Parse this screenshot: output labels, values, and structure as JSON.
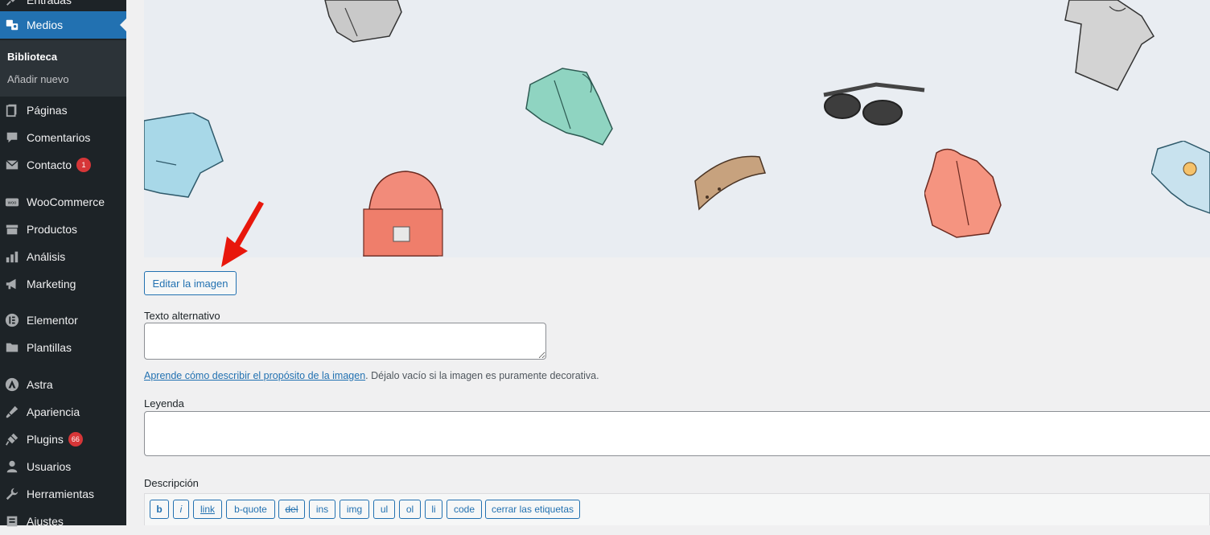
{
  "sidebar": {
    "items": [
      {
        "label": "Entradas",
        "icon": "pin-icon"
      },
      {
        "label": "Medios",
        "icon": "media-icon",
        "active": true
      },
      {
        "label": "Páginas",
        "icon": "pages-icon"
      },
      {
        "label": "Comentarios",
        "icon": "comments-icon"
      },
      {
        "label": "Contacto",
        "icon": "mail-icon",
        "badge": "1"
      },
      {
        "label": "WooCommerce",
        "icon": "woocommerce-icon"
      },
      {
        "label": "Productos",
        "icon": "products-icon"
      },
      {
        "label": "Análisis",
        "icon": "analytics-icon"
      },
      {
        "label": "Marketing",
        "icon": "megaphone-icon"
      },
      {
        "label": "Elementor",
        "icon": "elementor-icon"
      },
      {
        "label": "Plantillas",
        "icon": "folder-icon"
      },
      {
        "label": "Astra",
        "icon": "astra-icon"
      },
      {
        "label": "Apariencia",
        "icon": "brush-icon"
      },
      {
        "label": "Plugins",
        "icon": "plugin-icon",
        "badge": "66"
      },
      {
        "label": "Usuarios",
        "icon": "users-icon"
      },
      {
        "label": "Herramientas",
        "icon": "wrench-icon"
      },
      {
        "label": "Ajustes",
        "icon": "settings-icon"
      }
    ],
    "submenu": [
      {
        "label": "Biblioteca",
        "current": true
      },
      {
        "label": "Añadir nuevo"
      }
    ]
  },
  "editor": {
    "edit_image_label": "Editar la imagen",
    "alt_text_label": "Texto alternativo",
    "alt_text_value": "",
    "alt_help_link": "Aprende cómo describir el propósito de la imagen",
    "alt_help_text": ". Déjalo vacío si la imagen es puramente decorativa.",
    "caption_label": "Leyenda",
    "caption_value": "",
    "description_label": "Descripción",
    "toolbar_buttons": [
      "b",
      "i",
      "link",
      "b-quote",
      "del",
      "ins",
      "img",
      "ul",
      "ol",
      "li",
      "code",
      "cerrar las etiquetas"
    ]
  },
  "colors": {
    "sidebar_bg": "#1d2327",
    "accent": "#2271b1",
    "badge": "#d63638",
    "page_bg": "#f0f0f1",
    "annotation_arrow": "#e8170c"
  }
}
